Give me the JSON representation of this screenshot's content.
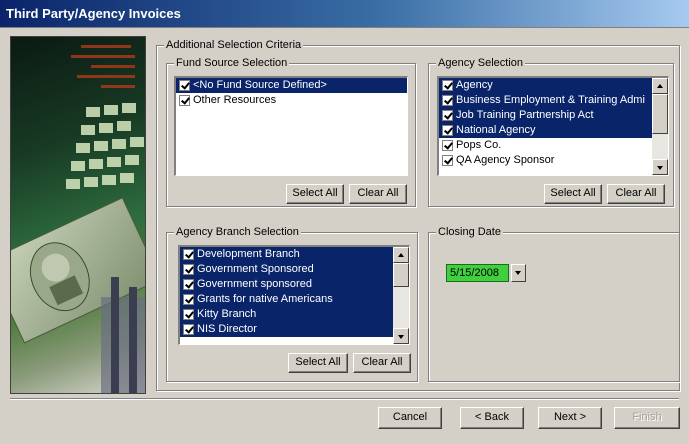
{
  "window": {
    "title": "Third Party/Agency Invoices"
  },
  "criteria": {
    "legend": "Additional Selection Criteria"
  },
  "fund_source": {
    "legend": "Fund Source Selection",
    "items": [
      {
        "label": "<No Fund Source Defined>",
        "checked": true,
        "selected": true
      },
      {
        "label": "Other Resources",
        "checked": true,
        "selected": false
      }
    ],
    "select_all": "Select All",
    "clear_all": "Clear All"
  },
  "agency": {
    "legend": "Agency Selection",
    "items": [
      {
        "label": "Agency",
        "checked": true,
        "selected": true
      },
      {
        "label": "Business Employment & Training Admi",
        "checked": true,
        "selected": true
      },
      {
        "label": "Job Training Partnership Act",
        "checked": true,
        "selected": true
      },
      {
        "label": "National Agency",
        "checked": true,
        "selected": true
      },
      {
        "label": "Pops Co.",
        "checked": true,
        "selected": false
      },
      {
        "label": "QA Agency Sponsor",
        "checked": true,
        "selected": false
      }
    ],
    "select_all": "Select All",
    "clear_all": "Clear All"
  },
  "branch": {
    "legend": "Agency Branch Selection",
    "items": [
      {
        "label": "Development Branch",
        "checked": true,
        "selected": true
      },
      {
        "label": "Government Sponsored",
        "checked": true,
        "selected": true
      },
      {
        "label": "Government sponsored",
        "checked": true,
        "selected": true
      },
      {
        "label": "Grants for native Americans",
        "checked": true,
        "selected": true
      },
      {
        "label": "Kitty Branch",
        "checked": true,
        "selected": true
      },
      {
        "label": "NIS Director",
        "checked": true,
        "selected": true
      }
    ],
    "select_all": "Select All",
    "clear_all": "Clear All"
  },
  "closing": {
    "legend": "Closing Date",
    "value": "5/15/2008",
    "color": "#3fcf3f"
  },
  "nav": {
    "cancel": "Cancel",
    "back": "< Back",
    "next": "Next >",
    "finish": "Finish"
  }
}
